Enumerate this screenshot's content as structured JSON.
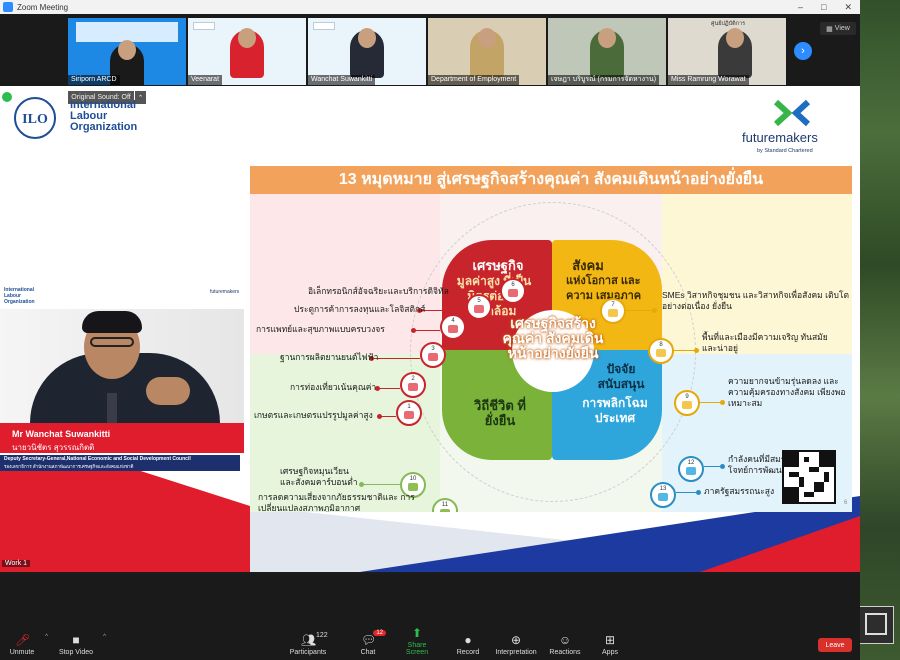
{
  "window": {
    "title": "Zoom Meeting",
    "controls": [
      "–",
      "□",
      "✕"
    ]
  },
  "gallery": {
    "view_label": "View",
    "next_label": "›",
    "tiles": [
      {
        "name": "Siriporn ARCD"
      },
      {
        "name": "Veenarat"
      },
      {
        "name": "Wanchat Suwankitti"
      },
      {
        "name": "Department of Employment"
      },
      {
        "name": "เจษฎา บริบูรณ์ (กรมการจัดหางาน)"
      },
      {
        "name": "Miss Ramrung Worawat"
      }
    ],
    "tile6_caption": "ศูนย์ปฏิบัติการ"
  },
  "share": {
    "original_sound": "Original Sound: Off",
    "original_sound_caret": "⌃",
    "ilo": {
      "line1": "International",
      "line2": "Labour",
      "line3": "Organization"
    },
    "futuremakers": {
      "name": "futuremakers",
      "sub": "by Standard Chartered"
    },
    "speaker": {
      "ilo_l1": "International",
      "ilo_l2": "Labour",
      "ilo_l3": "Organization",
      "fm": "futuremakers",
      "name_en": "Mr Wanchat Suwankitti",
      "name_th": "นายวนิชัตร สุวรรณกิตติ",
      "position_en": "Deputy Secretary-General,National Economic and Social Development Council",
      "position_th": "รองเลขาธิการ สำนักงานสภาพัฒนาการเศรษฐกิจและสังคมแห่งชาติ"
    },
    "work_label": "Work 1",
    "slide": {
      "title": "13 หมุดหมาย สู่เศรษฐกิจสร้างคุณค่า สังคมเดินหน้าอย่างยั่งยืน",
      "center": "เศรษฐกิจสร้างคุณค่า สังคมเดินหน้าอย่างยั่งยืน",
      "red_title": "เศรษฐกิจ",
      "red_sub": "มูลค่าสูง ที่เป็นมิตรต่อ สิ่งแวดล้อม",
      "yel_title": "สังคม",
      "yel_sub": "แห่งโอกาส และความ เสมอภาค",
      "grn_title": "วิถีชีวิต ที่ยั่งยืน",
      "blu_title": "ปัจจัย สนับสนุน",
      "blu_sub": "การพลิกโฉม ประเทศ",
      "page": "6",
      "goals": [
        {
          "n": "1",
          "text": "เกษตรและเกษตรแปรรูปมูลค่าสูง"
        },
        {
          "n": "2",
          "text": "การท่องเที่ยวเน้นคุณค่า"
        },
        {
          "n": "3",
          "text": "ฐานการผลิตยานยนต์ไฟฟ้า"
        },
        {
          "n": "4",
          "text": "การแพทย์และสุขภาพแบบครบวงจร"
        },
        {
          "n": "5",
          "text": "ประตูการค้าการลงทุนและโลจิสติกส์"
        },
        {
          "n": "6",
          "text": "อิเล็กทรอนิกส์อัจฉริยะและบริการดิจิทัล"
        },
        {
          "n": "7",
          "text": "SMEs วิสาหกิจชุมชน และวิสาหกิจเพื่อสังคม เติบโตอย่างต่อเนื่อง ยั่งยืน"
        },
        {
          "n": "8",
          "text": "พื้นที่และเมืองมีความเจริญ ทันสมัย และน่าอยู่"
        },
        {
          "n": "9",
          "text": "ความยากจนข้ามรุ่นลดลง และความคุ้มครองทางสังคม เพียงพอ เหมาะสม"
        },
        {
          "n": "10",
          "text": "เศรษฐกิจหมุนเวียน และสังคมคาร์บอนต่ำ"
        },
        {
          "n": "11",
          "text": "การลดความเสี่ยงจากภัยธรรมชาติและ การเปลี่ยนแปลงสภาพภูมิอากาศ"
        },
        {
          "n": "12",
          "text": "กำลังคนที่มีสมรรถนะสูง ตอบโจทย์การพัฒนาแห่งอนาคต"
        },
        {
          "n": "13",
          "text": "ภาครัฐสมรรถนะสูง"
        }
      ]
    }
  },
  "toolbar": {
    "items": [
      {
        "label": "Unmute",
        "icon": "mic-muted-icon"
      },
      {
        "label": "Stop Video",
        "icon": "video-icon"
      },
      {
        "label": "Participants",
        "icon": "participants-icon",
        "count": "122"
      },
      {
        "label": "Chat",
        "icon": "chat-icon",
        "badge": "12"
      },
      {
        "label": "Share Screen",
        "icon": "share-screen-icon"
      },
      {
        "label": "Record",
        "icon": "record-icon"
      },
      {
        "label": "Interpretation",
        "icon": "globe-icon"
      },
      {
        "label": "Reactions",
        "icon": "reactions-icon"
      },
      {
        "label": "Apps",
        "icon": "apps-icon"
      }
    ],
    "leave_label": "Leave"
  },
  "colors": {
    "red": "#c8242b",
    "yellow": "#f3b714",
    "green": "#7ab23a",
    "blue": "#2ea6dc",
    "title_bar": "#f2a25b",
    "zoom_blue": "#2d8cff",
    "leave_red": "#d9302b"
  }
}
